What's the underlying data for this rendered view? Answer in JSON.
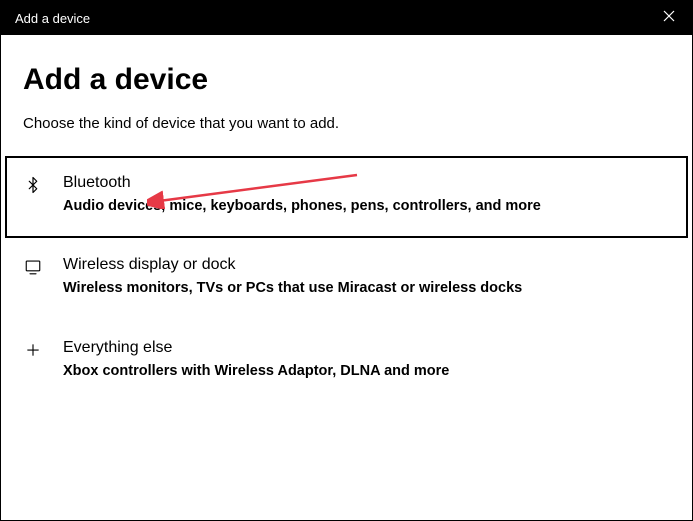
{
  "titlebar": {
    "title": "Add a device"
  },
  "page": {
    "heading": "Add a device",
    "subheading": "Choose the kind of device that you want to add."
  },
  "options": [
    {
      "id": "bluetooth",
      "title": "Bluetooth",
      "description": "Audio devices, mice, keyboards, phones, pens, controllers, and more",
      "highlighted": true
    },
    {
      "id": "wireless-display",
      "title": "Wireless display or dock",
      "description": "Wireless monitors, TVs or PCs that use Miracast or wireless docks",
      "highlighted": false
    },
    {
      "id": "everything-else",
      "title": "Everything else",
      "description": "Xbox controllers with Wireless Adaptor, DLNA and more",
      "highlighted": false
    }
  ],
  "annotation": {
    "arrow_color": "#e63946"
  }
}
